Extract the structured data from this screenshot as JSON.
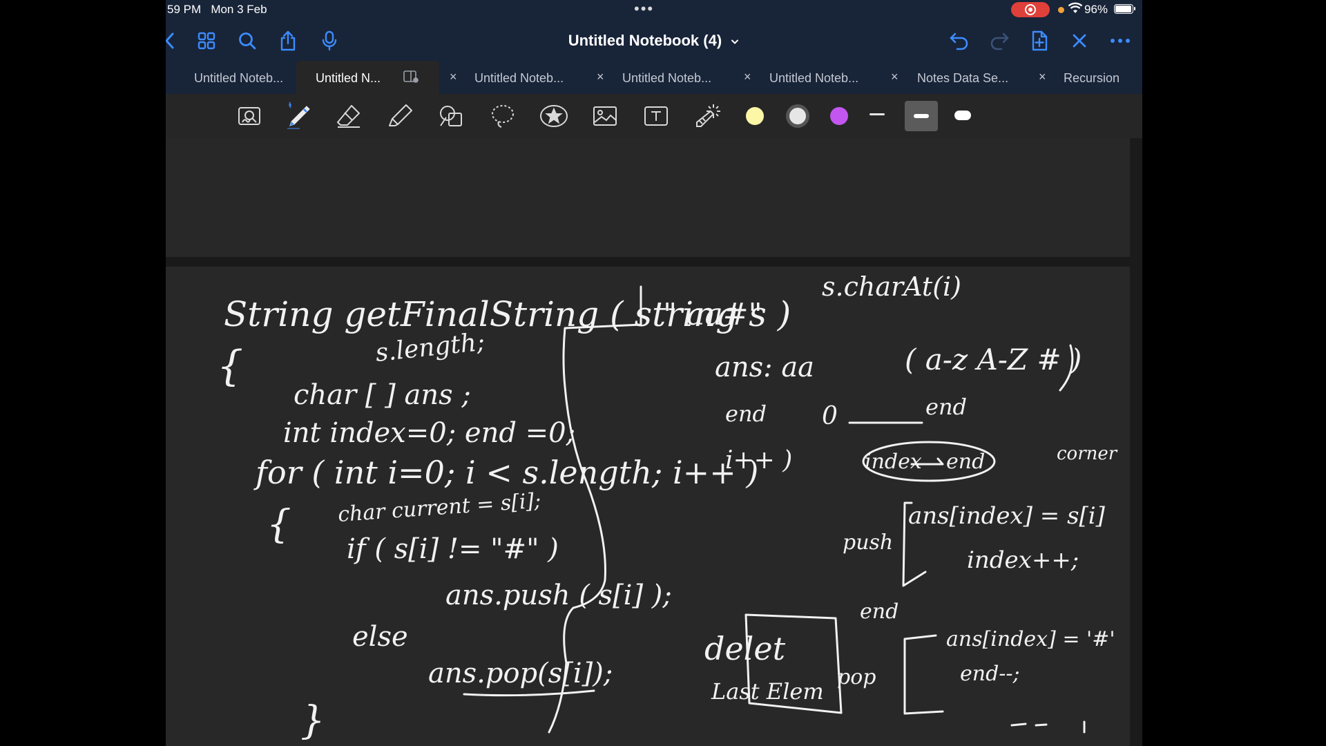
{
  "status": {
    "time": "59 PM",
    "date": "Mon 3 Feb",
    "battery": "96%"
  },
  "nav": {
    "title": "Untitled Notebook (4)"
  },
  "tabs": [
    {
      "label": "Untitled Noteb...",
      "close": "×"
    },
    {
      "label": "Untitled N...",
      "close": "×",
      "active": true
    },
    {
      "label": "Untitled Noteb...",
      "close": "×"
    },
    {
      "label": "Untitled Noteb...",
      "close": "×"
    },
    {
      "label": "Untitled Noteb...",
      "close": "×"
    },
    {
      "label": "Notes Data Se...",
      "close": "×"
    },
    {
      "label": "Recursion"
    }
  ],
  "toolbar": {
    "colors": [
      "#fbf7a6",
      "#e6e6e6",
      "#c356f0"
    ],
    "tools": [
      "zoom-window",
      "pen",
      "eraser",
      "highlighter",
      "shapes",
      "lasso",
      "sticker",
      "image",
      "text",
      "laser-pointer"
    ]
  },
  "handwriting": {
    "header": "String getFinalString ( string s )",
    "l_strlen": "s.length;",
    "l_char": "char [ ]  ans ;",
    "l_int": "int index=0; end =0;",
    "l_for": "for ( int i=0; i < s.length; i++ )",
    "l_char2": "char current = s[i];",
    "l_if": "if ( s[i] != \"#\" )",
    "l_push": "ans.push ( s[i] );",
    "l_else": "else",
    "l_pop": "ans.pop(s[i]);",
    "r_top": "\" aa#\"",
    "r_charat": "s.charAt(i)",
    "r_ans": "ans: aa",
    "r_range": "( a-z A-Z # )",
    "r_end": "end",
    "r_zero": "0",
    "r_end2": "end",
    "r_ipp": "i++ )",
    "r_index": "index",
    "r_end3": "end",
    "r_corner": "corner",
    "r_push": "push",
    "r_assign": "ans[index] = s[i]",
    "r_idxpp": "index++;",
    "r_endlbl": "end",
    "r_delete": "delet",
    "r_last": "Last Elem",
    "r_pop": "pop",
    "r_assign2": "ans[index] = '#'",
    "r_endmm": "end--;",
    "brace": "{",
    "brace2": "{",
    "close": "}"
  }
}
